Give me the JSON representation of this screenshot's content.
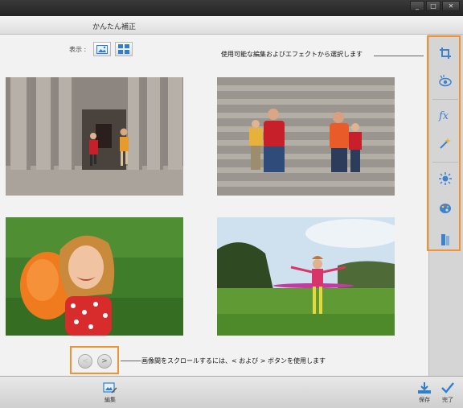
{
  "window": {
    "minimize_glyph": "_",
    "maximize_glyph": "□",
    "close_glyph": "✕"
  },
  "header": {
    "title": "かんたん補正"
  },
  "view": {
    "label": "表示 :",
    "modes": [
      "single-photo-icon",
      "grid-view-icon"
    ],
    "selected": "grid-view-icon"
  },
  "photos": [
    {
      "name": "children-running-colonnade"
    },
    {
      "name": "family-on-steps"
    },
    {
      "name": "girl-with-orange-ball"
    },
    {
      "name": "girl-with-hula-hoop"
    }
  ],
  "callouts": {
    "effects_panel": "使用可能な編集およびエフェクトから選択します",
    "scroll_nav": "画像間をスクロールするには、< および > ボタンを使用します"
  },
  "nav": {
    "prev": "<",
    "next": ">"
  },
  "side_tools": [
    "crop-icon",
    "red-eye-icon",
    "effects-fx-icon",
    "auto-fix-wand-icon",
    "brightness-icon",
    "color-palette-icon",
    "straighten-icon"
  ],
  "footer": {
    "edit_label": "編集",
    "save_label": "保存",
    "done_label": "完了"
  },
  "colors": {
    "highlight": "#f29233",
    "accent_blue": "#2d7fd3"
  }
}
